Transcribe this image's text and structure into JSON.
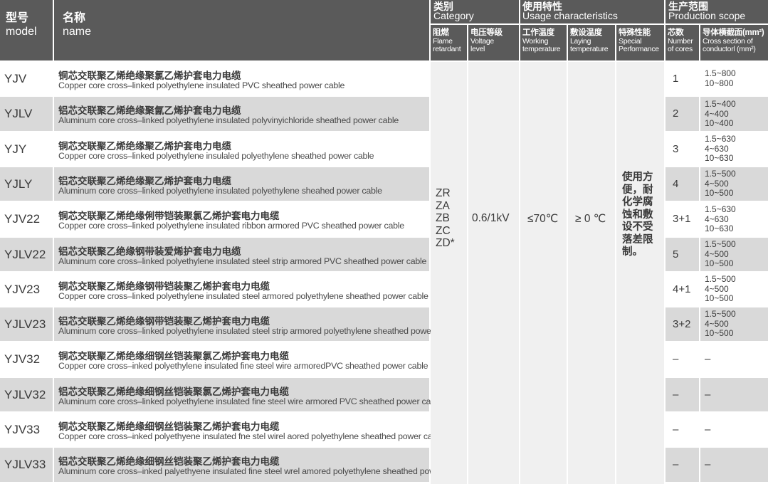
{
  "header": {
    "model_cn": "型号",
    "model_en": "model",
    "name_cn": "名称",
    "name_en": "name",
    "category_cn": "类别",
    "category_en": "Category",
    "usage_cn": "使用特性",
    "usage_en": "Usage characteristics",
    "production_cn": "生产范围",
    "production_en": "Production scope",
    "sub": [
      {
        "cn": "阻燃",
        "en1": "Flame",
        "en2": "retardant"
      },
      {
        "cn": "电压等级",
        "en1": "Voltage",
        "en2": "level"
      },
      {
        "cn": "工作温度",
        "en1": "Working",
        "en2": "temperature"
      },
      {
        "cn": "敷设温度",
        "en1": "Laying",
        "en2": "temperature"
      },
      {
        "cn": "特殊性能",
        "en1": "Special",
        "en2": "Performance"
      },
      {
        "cn": "芯数",
        "en1": "Number",
        "en2": "of cores"
      },
      {
        "cn": "导体横截面(mm²)",
        "en1": "Cross section of",
        "en2": "conductorl (mm²)"
      }
    ]
  },
  "flame_grades": [
    "ZR",
    "ZA",
    "ZB",
    "ZC",
    "ZD*"
  ],
  "voltage": "0.6/1kV",
  "working_temp": "≤70℃",
  "laying_temp": "≥ 0 ℃",
  "special_lines": [
    "使用方",
    "便，耐",
    "化学腐",
    "蚀和敷",
    "设不受",
    "落差限",
    "制。"
  ],
  "rows": [
    {
      "model": "YJV",
      "cn": "铜芯交联聚乙烯绝缘聚氯乙烯护套电力电缆",
      "en": "Copper core cross–linked polyethylene insulated PVC sheathed power cable",
      "cores": "1",
      "sec": [
        "1.5~800",
        "10~800"
      ]
    },
    {
      "model": "YJLV",
      "cn": "铝芯交联聚乙烯绝缘聚氤乙烯护套电力电缆",
      "en": "Aluminum core cross–linked polyethylene insulated polyvinyichloride sheathed power cable",
      "cores": "2",
      "sec": [
        "1.5~400",
        "4~400",
        "10~400"
      ]
    },
    {
      "model": "YJY",
      "cn": "铜芯交联聚乙烯绝缘聚乙烯护套电力电缆",
      "en": "Copper core cross–linked polyethylene insulaled polyethylene sheathed power cable",
      "cores": "3",
      "sec": [
        "1.5~630",
        "4~630",
        "10~630"
      ]
    },
    {
      "model": "YJLY",
      "cn": "铝芯交联聚乙烯绝缘聚乙烯护套电力电缆",
      "en": "Aluminum core cross–linked polyethylene insulated polyethylene sheahed power cable",
      "cores": "4",
      "sec": [
        "1.5~500",
        "4~500",
        "10~500"
      ]
    },
    {
      "model": "YJV22",
      "cn": "铜芯交联聚乙烯绝缘俐带铠装聚氯乙烯护套电力电缆",
      "en": "Copper core cross–linked polyethylene insulated ribbon armored PVC sheathed power cable",
      "cores": "3+1",
      "sec": [
        "1.5~630",
        "4~630",
        "10~630"
      ]
    },
    {
      "model": "YJLV22",
      "cn": "铝芯交联聚乙绝缘钢带装爱烯护套电力电缆",
      "en": "Aluminum core cross–linked polyethylene insulated steel strip armored PVC sheathed power cable",
      "cores": "5",
      "sec": [
        "1.5~500",
        "4~500",
        "10~500"
      ]
    },
    {
      "model": "YJV23",
      "cn": "铜芯交联聚乙烯绝缘钢带铠装聚乙烯护套电力电缆",
      "en": "Copper core cross–linked polyethylene insulated steel armored polyethylene sheathed power cable",
      "cores": "4+1",
      "sec": [
        "1.5~500",
        "4~500",
        "10~500"
      ]
    },
    {
      "model": "YJLV23",
      "cn": "铝芯交联聚乙烯绝缘钢带铠装聚乙烯护套电力电缆",
      "en": "Aluminum core cross–linked polyethylene insulated steel strip armored polyethylene sheathed power cable",
      "cores": "3+2",
      "sec": [
        "1.5~500",
        "4~500",
        "10~500"
      ]
    },
    {
      "model": "YJV32",
      "cn": "铜芯交联聚乙烯绝缘细钢丝铠装聚氯乙烯护套电力电缆",
      "en": "Copper core cross–inked polyethylene insulated fine steel wire armoredPVC sheathed power cable",
      "cores": "–",
      "sec": [
        "–"
      ]
    },
    {
      "model": "YJLV32",
      "cn": "铝芯交联聚乙烯绝缘细钢丝铠装聚氯乙烯护套电力电缆",
      "en": "Aluminum core cross–linked polyethylene insulated fine steel wire armored PVC sheathed power cable",
      "cores": "–",
      "sec": [
        "–"
      ]
    },
    {
      "model": "YJV33",
      "cn": "铜芯交联聚乙烯绝缘细钢丝铠装聚乙烯护套电力电缆",
      "en": "Copper core cross–inked polyethyene insulated fne stel wirel aored polyethylene sheathed power cable",
      "cores": "–",
      "sec": [
        "–"
      ]
    },
    {
      "model": "YJLV33",
      "cn": "铝芯交联聚乙烯绝缘细钢丝铠装聚乙烯护套电力电缆",
      "en": "Aluminum core cross–inked palyethyene insulated fine steel wrel amored polyethylene sheathed power cable",
      "cores": "–",
      "sec": [
        "–"
      ]
    }
  ]
}
